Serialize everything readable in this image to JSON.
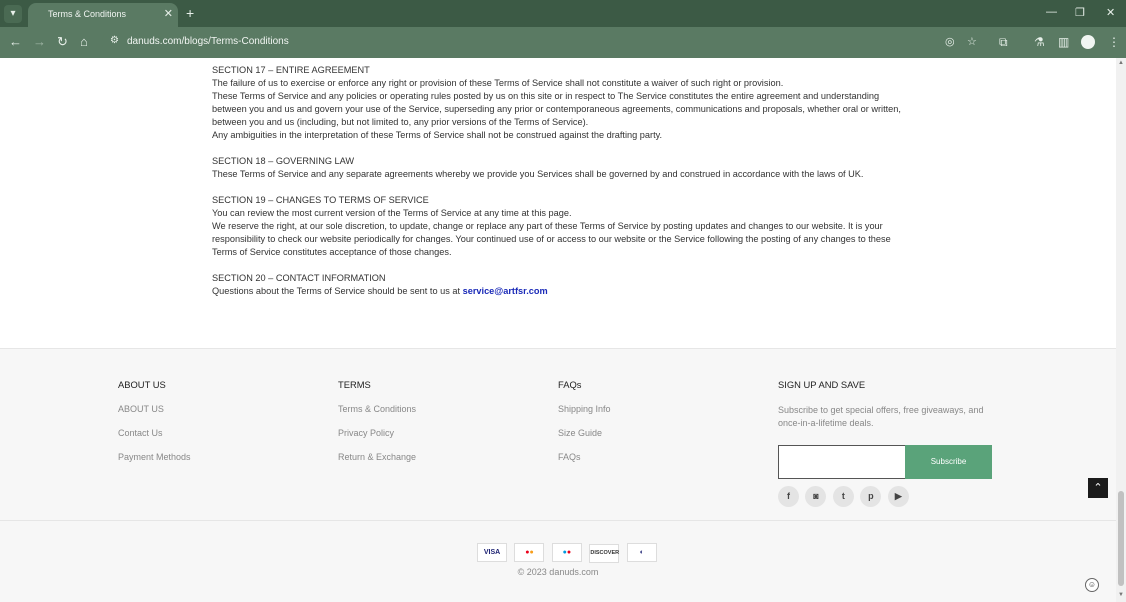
{
  "browser": {
    "tab_title": "Terms & Conditions",
    "url": "danuds.com/blogs/Terms-Conditions"
  },
  "terms": {
    "sections": [
      {
        "heading": "SECTION 17 – ENTIRE AGREEMENT",
        "lines": [
          "The failure of us to exercise or enforce any right or provision of these Terms of Service shall not constitute a waiver of such right or provision.",
          "These Terms of Service and any policies or operating rules posted by us on this site or in respect to The Service constitutes the entire agreement and understanding",
          "between you and us and govern your use of the Service, superseding any prior or contemporaneous agreements, communications and proposals, whether oral or written,",
          "between you and us (including, but not limited to, any prior versions of the Terms of Service).",
          "Any ambiguities in the interpretation of these Terms of Service shall not be construed against the drafting party."
        ]
      },
      {
        "heading": "SECTION 18 – GOVERNING LAW",
        "lines": [
          "These Terms of Service and any separate agreements whereby we provide you Services shall be governed by and construed in accordance with the laws of UK."
        ]
      },
      {
        "heading": "SECTION 19 – CHANGES TO TERMS OF SERVICE",
        "lines": [
          "You can review the most current version of the Terms of Service at any time at this page.",
          "We reserve the right, at our sole discretion, to update, change or replace any part of these Terms of Service by posting updates and changes to our website. It is your",
          "responsibility to check our website periodically for changes. Your continued use of or access to our website or the Service following the posting of any changes to these",
          "Terms of Service constitutes acceptance of those changes."
        ]
      },
      {
        "heading": "SECTION 20 – CONTACT INFORMATION",
        "text": "Questions about the Terms of Service should be sent to us at",
        "email": "service@artfsr.com"
      }
    ]
  },
  "footer": {
    "about": {
      "heading": "ABOUT US",
      "links": [
        "ABOUT US",
        "Contact Us",
        "Payment Methods"
      ]
    },
    "terms": {
      "heading": "TERMS",
      "links": [
        "Terms & Conditions",
        "Privacy Policy",
        "Return & Exchange"
      ]
    },
    "faqs": {
      "heading": "FAQs",
      "links": [
        "Shipping Info",
        "Size Guide",
        "FAQs"
      ]
    },
    "signup": {
      "heading": "SIGN UP AND SAVE",
      "text": "Subscribe to get special offers, free giveaways, and once-in-a-lifetime deals.",
      "email_value": "",
      "button": "Subscribe"
    },
    "socials": [
      "facebook-icon",
      "instagram-icon",
      "twitter-icon",
      "pinterest-icon",
      "youtube-icon"
    ],
    "payments": [
      "VISA",
      "mastercard-icon",
      "maestro-icon",
      "DISCOVER",
      "diners-club-icon"
    ],
    "copyright": "© 2023 danuds.com"
  },
  "colors": {
    "chrome": "#3c5a45",
    "toolbar": "#5a7a63",
    "subscribe": "#5aa37a",
    "link": "#1a2ab8"
  }
}
